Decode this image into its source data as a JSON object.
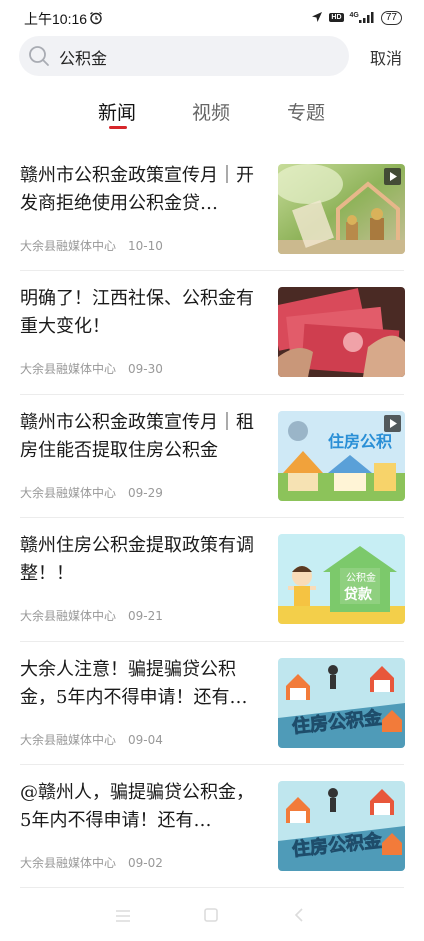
{
  "status_bar": {
    "time": "上午10:16",
    "network": "4G",
    "hd": "HD",
    "battery": "77"
  },
  "search": {
    "query": "公积金",
    "cancel_label": "取消"
  },
  "tabs": [
    {
      "label": "新闻",
      "active": true
    },
    {
      "label": "视频",
      "active": false
    },
    {
      "label": "专题",
      "active": false
    }
  ],
  "articles": [
    {
      "title": "赣州市公积金政策宣传月｜开发商拒绝使用公积金贷…",
      "source": "大余县融媒体中心",
      "date": "10-10",
      "thumb": "house-coins-photo",
      "video": true
    },
    {
      "title": "明确了！江西社保、公积金有重大变化！",
      "source": "大余县融媒体中心",
      "date": "09-30",
      "thumb": "banknotes-photo",
      "video": false
    },
    {
      "title": "赣州市公积金政策宣传月｜租房住能否提取住房公积金",
      "source": "大余县融媒体中心",
      "date": "09-29",
      "thumb": "housing-fund-illustration",
      "video": true,
      "thumb_text": "住房公积"
    },
    {
      "title": "赣州住房公积金提取政策有调整！！",
      "source": "大余县融媒体中心",
      "date": "09-21",
      "thumb": "fund-loan-illustration",
      "video": false,
      "thumb_text_1": "公积金",
      "thumb_text_2": "贷款"
    },
    {
      "title": "大余人注意！骗提骗贷公积金，5年内不得申请！还有…",
      "source": "大余县融媒体中心",
      "date": "09-04",
      "thumb": "housing-fund-3d-text",
      "video": false,
      "thumb_text": "住房公积金"
    },
    {
      "title": "@赣州人，骗提骗贷公积金，5年内不得申请！还有…",
      "source": "大余县融媒体中心",
      "date": "09-02",
      "thumb": "housing-fund-3d-text",
      "video": false,
      "thumb_text": "住房公积金"
    }
  ],
  "colors": {
    "accent": "#d7262a",
    "search_bg": "#f1f2f5",
    "meta_text": "#999999"
  }
}
